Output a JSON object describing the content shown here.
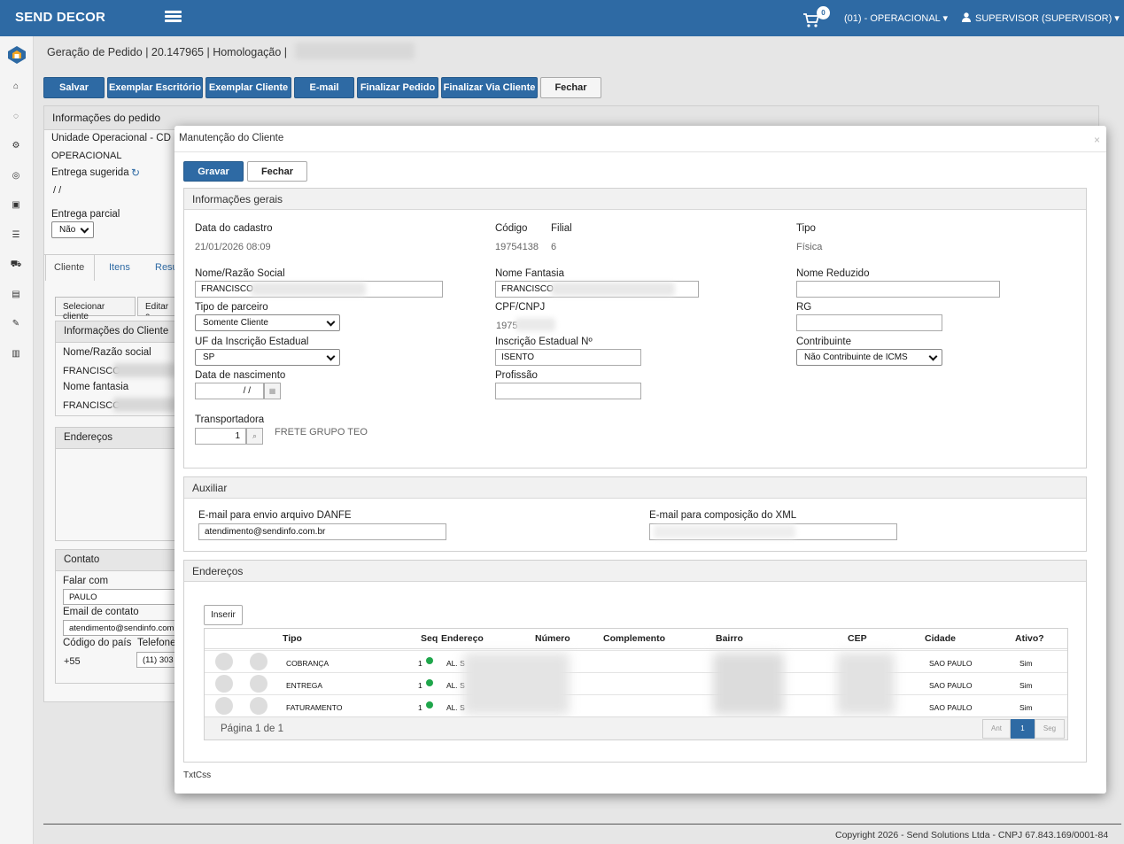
{
  "header": {
    "brand": "SEND DECOR",
    "cart_count": "0",
    "unit": "(01) - OPERACIONAL",
    "user": "SUPERVISOR (SUPERVISOR)"
  },
  "breadcrumb": "Geração de Pedido | 20.147965 | Homologação |",
  "toolbar": {
    "save": "Salvar",
    "copy_office": "Exemplar Escritório",
    "copy_client": "Exemplar Cliente",
    "email": "E-mail",
    "finish": "Finalizar Pedido",
    "finish_client": "Finalizar Via Cliente",
    "close": "Fechar"
  },
  "order_info": {
    "title": "Informações do pedido",
    "unit_label": "Unidade Operacional - CD",
    "unit_value": "OPERACIONAL",
    "delivery_label": "Entrega sugerida",
    "delivery_value": "/ /",
    "partial_label": "Entrega parcial",
    "partial_value": "Não"
  },
  "tabs": [
    "Cliente",
    "Itens",
    "Resu"
  ],
  "client_panel": {
    "select_btn": "Selecionar cliente",
    "edit_btn": "Editar c",
    "info_title": "Informações do Cliente",
    "name_label": "Nome/Razão social",
    "name_value": "FRANCISCO",
    "fantasy_label": "Nome fantasia",
    "fantasy_value": "FRANCISCO",
    "addresses_title": "Endereços",
    "contact_title": "Contato",
    "talk_label": "Falar com",
    "talk_value": "PAULO",
    "email_label": "Email de contato",
    "email_value": "atendimento@sendinfo.com",
    "country_label": "Código do país",
    "country_value": "+55",
    "phone_label": "Telefone",
    "phone_value": "(11) 303"
  },
  "modal": {
    "title": "Manutenção do Cliente",
    "save": "Gravar",
    "close": "Fechar",
    "general_title": "Informações gerais",
    "created_label": "Data do cadastro",
    "created_value": "21/01/2026 08:09",
    "code_label": "Código",
    "code_value": "19754138",
    "branch_label": "Filial",
    "branch_value": "6",
    "type_label": "Tipo",
    "type_value": "Física",
    "name_label": "Nome/Razão Social",
    "name_value": "FRANCISCO",
    "fantasy_label": "Nome Fantasia",
    "fantasy_value": "FRANCISCO",
    "short_label": "Nome Reduzido",
    "partner_label": "Tipo de parceiro",
    "partner_value": "Somente Cliente",
    "cpf_label": "CPF/CNPJ",
    "cpf_value": "1975",
    "rg_label": "RG",
    "uf_label": "UF da Inscrição Estadual",
    "uf_value": "SP",
    "ie_label": "Inscrição Estadual Nº",
    "ie_value": "ISENTO",
    "taxpayer_label": "Contribuinte",
    "taxpayer_value": "Não Contribuinte de ICMS",
    "birth_label": "Data de nascimento",
    "birth_value": "/ /",
    "job_label": "Profissão",
    "carrier_label": "Transportadora",
    "carrier_value": "1",
    "carrier_name": "FRETE GRUPO TEO",
    "aux_title": "Auxiliar",
    "danfe_label": "E-mail para envio arquivo DANFE",
    "danfe_value": "atendimento@sendinfo.com.br",
    "xml_label": "E-mail para composição do XML",
    "addr_title": "Endereços",
    "insert": "Inserir",
    "columns": [
      "Tipo",
      "Seq",
      "Endereço",
      "Número",
      "Complemento",
      "Bairro",
      "CEP",
      "Cidade",
      "Ativo?"
    ],
    "rows": [
      {
        "tipo": "COBRANÇA",
        "seq": "1",
        "end": "AL. S",
        "cidade": "SAO PAULO",
        "ativo": "Sim"
      },
      {
        "tipo": "ENTREGA",
        "seq": "1",
        "end": "AL. S",
        "cidade": "SAO PAULO",
        "ativo": "Sim"
      },
      {
        "tipo": "FATURAMENTO",
        "seq": "1",
        "end": "AL. S",
        "cidade": "SAO PAULO",
        "ativo": "Sim"
      }
    ],
    "page_info": "Página 1 de 1",
    "prev": "Ant",
    "page": "1",
    "next": "Seg",
    "footer_text": "TxtCss"
  },
  "footer": "Copyright 2026 - Send Solutions Ltda - CNPJ 67.843.169/0001-84"
}
